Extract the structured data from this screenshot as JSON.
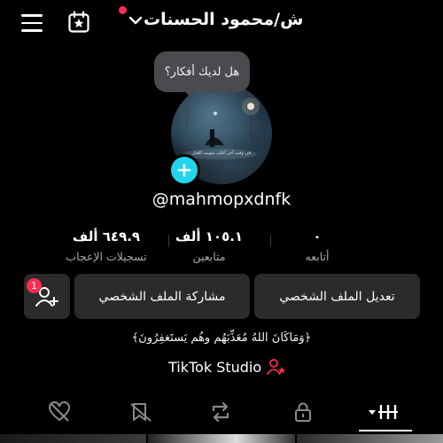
{
  "header": {
    "title": "ش/محمود الحسنات",
    "icons": [
      "menu-icon",
      "calendar-star-icon",
      "chevron-down-icon"
    ],
    "notification_color": "#fe2c55"
  },
  "profile": {
    "bubble_text": "هل لديك أفكار؟",
    "avatar_caption": "في وقت آخر أغلب ينتوبت الغبار",
    "handle": "@mahmopxdnfk",
    "add_color": "#20d5ec"
  },
  "stats": [
    {
      "number": "٦٤٩.٩ ألف",
      "label": "تسجيلات الإعجاب"
    },
    {
      "number": "١٠٥.١ ألف",
      "label": "متابعين"
    },
    {
      "number": "٠",
      "label": "أتابعه"
    }
  ],
  "buttons": {
    "edit_profile": "تعديل الملف الشخصي",
    "share_profile": "مشاركة الملف الشخصي",
    "add_friend_badge": "1"
  },
  "bio": "﴿وَمَاكَانَ اللهُ مُعَذِّبَهُم وهُم يَستَغفِرُونَ﴾",
  "studio": {
    "label": "TikTok Studio",
    "icon_color": "#fe2c55"
  },
  "tabs": [
    "liked-hidden-icon",
    "favorites-icon",
    "repost-icon",
    "private-lock-icon",
    "videos-grid-icon"
  ]
}
